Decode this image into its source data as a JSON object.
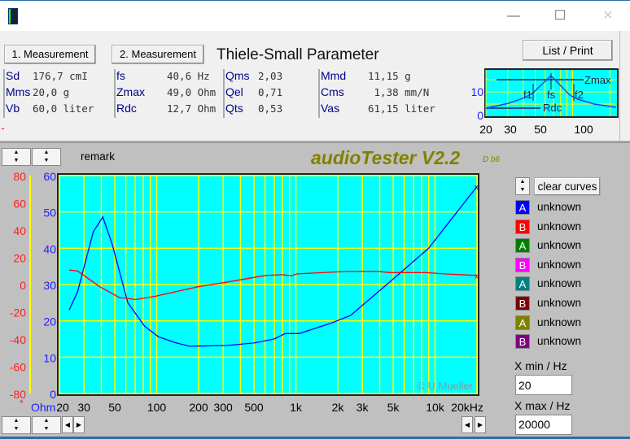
{
  "window": {
    "minimize": "—",
    "maximize": "☐",
    "close": "✕"
  },
  "top": {
    "btn1": "1. Measurement",
    "btn2": "2. Measurement",
    "title": "Thiele-Small Parameter",
    "list_print": "List / Print",
    "params": [
      [
        {
          "k": "Sd",
          "v": "176,7 cmI"
        },
        {
          "k": "Mms",
          "v": "20,0 g"
        },
        {
          "k": "Vb",
          "v": "60,0 liter"
        }
      ],
      [
        {
          "k": "fs",
          "v": "40,6 Hz"
        },
        {
          "k": "Zmax",
          "v": "49,0 Ohm"
        },
        {
          "k": "Rdc",
          "v": "12,7 Ohm"
        }
      ],
      [
        {
          "k": "Qms",
          "v": "2,03"
        },
        {
          "k": "Qel",
          "v": "0,71"
        },
        {
          "k": "Qts",
          "v": "0,53"
        }
      ],
      [
        {
          "k": "Mmd",
          "v": "11,15 g"
        },
        {
          "k": "Cms",
          "v": " 1,38 mm/N"
        },
        {
          "k": "Vas",
          "v": "61,15 liter"
        }
      ]
    ],
    "thumb": {
      "zmax": "Zmax",
      "f1": "f1",
      "fs": "fs",
      "f2": "f2",
      "rdc": "Rdc",
      "y10": "10",
      "y0": "0",
      "x": [
        "20",
        "30",
        "50",
        "100"
      ]
    }
  },
  "lower": {
    "remark": "remark",
    "app_title": "audioTester V2.2",
    "version": "D b6",
    "clear": "clear curves",
    "copyright": "© U.Mueller",
    "legend": [
      {
        "letter": "A",
        "label": "unknown",
        "color": "#0000ff"
      },
      {
        "letter": "B",
        "label": "unknown",
        "color": "#ff0000"
      },
      {
        "letter": "A",
        "label": "unknown",
        "color": "#008000"
      },
      {
        "letter": "B",
        "label": "unknown",
        "color": "#ff00ff"
      },
      {
        "letter": "A",
        "label": "unknown",
        "color": "#008080"
      },
      {
        "letter": "B",
        "label": "unknown",
        "color": "#800000"
      },
      {
        "letter": "A",
        "label": "unknown",
        "color": "#808000"
      },
      {
        "letter": "B",
        "label": "unknown",
        "color": "#800080"
      }
    ],
    "xmin_label": "X min / Hz",
    "xmin": "20",
    "xmax_label": "X max / Hz",
    "xmax": "20000"
  },
  "chart_data": {
    "type": "line",
    "xscale": "log",
    "xlim": [
      20,
      20000
    ],
    "x_ticks": [
      {
        "v": 20,
        "t": "20"
      },
      {
        "v": 30,
        "t": "30"
      },
      {
        "v": 50,
        "t": "50"
      },
      {
        "v": 100,
        "t": "100"
      },
      {
        "v": 200,
        "t": "200"
      },
      {
        "v": 300,
        "t": "300"
      },
      {
        "v": 500,
        "t": "500"
      },
      {
        "v": 1000,
        "t": "1k"
      },
      {
        "v": 2000,
        "t": "2k"
      },
      {
        "v": 3000,
        "t": "3k"
      },
      {
        "v": 5000,
        "t": "5k"
      },
      {
        "v": 10000,
        "t": "10k"
      },
      {
        "v": 20000,
        "t": "20kHz"
      }
    ],
    "y_left_ticks": [
      "80",
      "60",
      "40",
      "20",
      "0",
      "-20",
      "-40",
      "-60",
      "-80"
    ],
    "y_left_range": [
      -80,
      80
    ],
    "y_left_unit": "*",
    "y_right_ticks": [
      "60",
      "50",
      "40",
      "30",
      "20",
      "10",
      "0"
    ],
    "y_range": [
      0,
      60
    ],
    "y_unit": "Ohm",
    "series": [
      {
        "name": "impedance",
        "color": "#0000ff",
        "axis": "ohm",
        "x": [
          23.5,
          27,
          35,
          41,
          48,
          62,
          82,
          103,
          136,
          172,
          316,
          501,
          698,
          837,
          1056,
          1770,
          2470,
          4500,
          9000,
          20000
        ],
        "y": [
          23,
          28,
          44.5,
          48.6,
          41,
          25,
          18.5,
          15.6,
          14,
          13,
          13.2,
          13.9,
          15,
          16.5,
          16.5,
          19.3,
          21.5,
          30,
          40,
          57
        ]
      },
      {
        "name": "phase",
        "color": "#ff0000",
        "axis": "deg",
        "x": [
          23.5,
          27,
          39,
          54,
          71,
          98,
          198,
          300,
          606,
          804,
          929,
          1018,
          2320,
          3900,
          4700,
          8700,
          11500,
          20000
        ],
        "y": [
          10.7,
          10,
          -1.6,
          -9.6,
          -11,
          -8.6,
          -1.6,
          1.3,
          6.7,
          7.2,
          6.4,
          7.8,
          9.6,
          9.7,
          8.8,
          8.8,
          7.8,
          6.7
        ]
      }
    ]
  }
}
